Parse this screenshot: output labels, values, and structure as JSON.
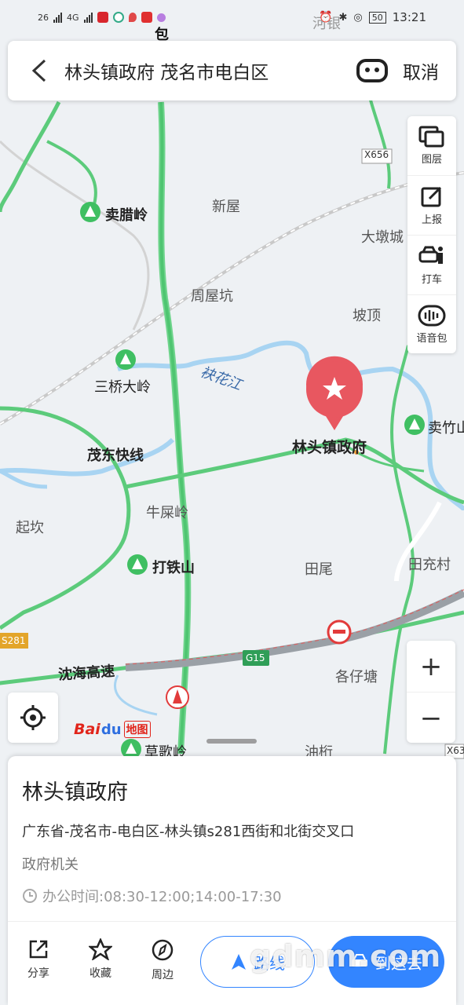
{
  "status_bar": {
    "signal1": "26",
    "signal2": "4G",
    "battery": "50",
    "time": "13:21"
  },
  "search": {
    "query": "林头镇政府 茂名市电白区",
    "cancel_label": "取消"
  },
  "tools": [
    {
      "label": "图层",
      "icon": "layers-icon"
    },
    {
      "label": "上报",
      "icon": "report-icon"
    },
    {
      "label": "打车",
      "icon": "taxi-icon"
    },
    {
      "label": "语音包",
      "icon": "voice-pack-icon"
    }
  ],
  "map": {
    "marker_label": "林头镇政府",
    "places": {
      "hebao": "河银",
      "baoflag": "包",
      "xinwu": "新屋",
      "maila": "卖腊岭",
      "dadun": "大墩城",
      "zhouwukeng": "周屋坑",
      "poding": "坡顶",
      "sanqiao": "三桥大岭",
      "river": "袂花江",
      "maizhu": "卖竹山",
      "maodong": "茂东快线",
      "niushi": "牛屎岭",
      "qikan": "起坎",
      "datie": "打铁山",
      "tianwei": "田尾",
      "tianchong": "田充村",
      "highway": "沈海高速",
      "gezai": "各仔塘",
      "cage": "草歌岭",
      "youhang": "油桁",
      "x656": "X656",
      "s281": "S281",
      "g15": "G15",
      "x63": "X63"
    }
  },
  "poi": {
    "name": "林头镇政府",
    "address": "广东省-茂名市-电白区-林头镇s281西街和北街交叉口",
    "category": "政府机关",
    "hours": "办公时间:08:30-12:00;14:00-17:30"
  },
  "actions": [
    {
      "label": "分享",
      "icon": "share-icon"
    },
    {
      "label": "收藏",
      "icon": "star-icon"
    },
    {
      "label": "周边",
      "icon": "compass-icon"
    }
  ],
  "buttons": {
    "route_label": "路线",
    "go_label": "到这去"
  },
  "zoom": {
    "in": "+",
    "out": "−"
  },
  "logo": {
    "bai": "Bai",
    "paw": "du",
    "dt": "地图"
  },
  "watermark": "gdmm.com"
}
